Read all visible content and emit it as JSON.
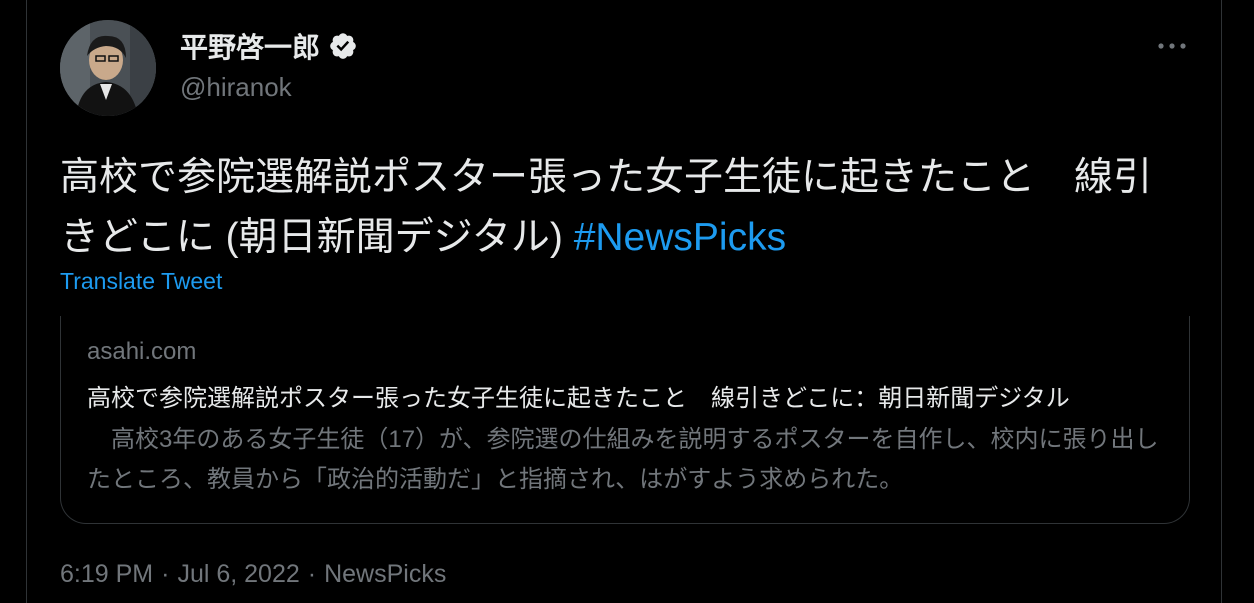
{
  "author": {
    "display_name": "平野啓一郎",
    "handle": "@hiranok",
    "verified": true
  },
  "tweet": {
    "text_main": "高校で参院選解説ポスター張った女子生徒に起きたこと　線引きどこに (朝日新聞デジタル) ",
    "hashtag": "#NewsPicks",
    "translate_label": "Translate Tweet"
  },
  "card": {
    "domain": "asahi.com",
    "title": "高校で参院選解説ポスター張った女子生徒に起きたこと　線引きどこに：朝日新聞デジタル",
    "description": "　高校3年のある女子生徒（17）が、参院選の仕組みを説明するポスターを自作し、校内に張り出したところ、教員から「政治的活動だ」と指摘され、はがすよう求められた。"
  },
  "meta": {
    "time": "6:19 PM",
    "date": "Jul 6, 2022",
    "separator": "·",
    "source": "NewsPicks"
  },
  "colors": {
    "background": "#000000",
    "text": "#e7e9ea",
    "secondary": "#71767b",
    "accent": "#1d9bf0",
    "border": "#2f3336"
  },
  "icons": {
    "verified": "verified-badge-icon",
    "more": "more-options-icon"
  }
}
